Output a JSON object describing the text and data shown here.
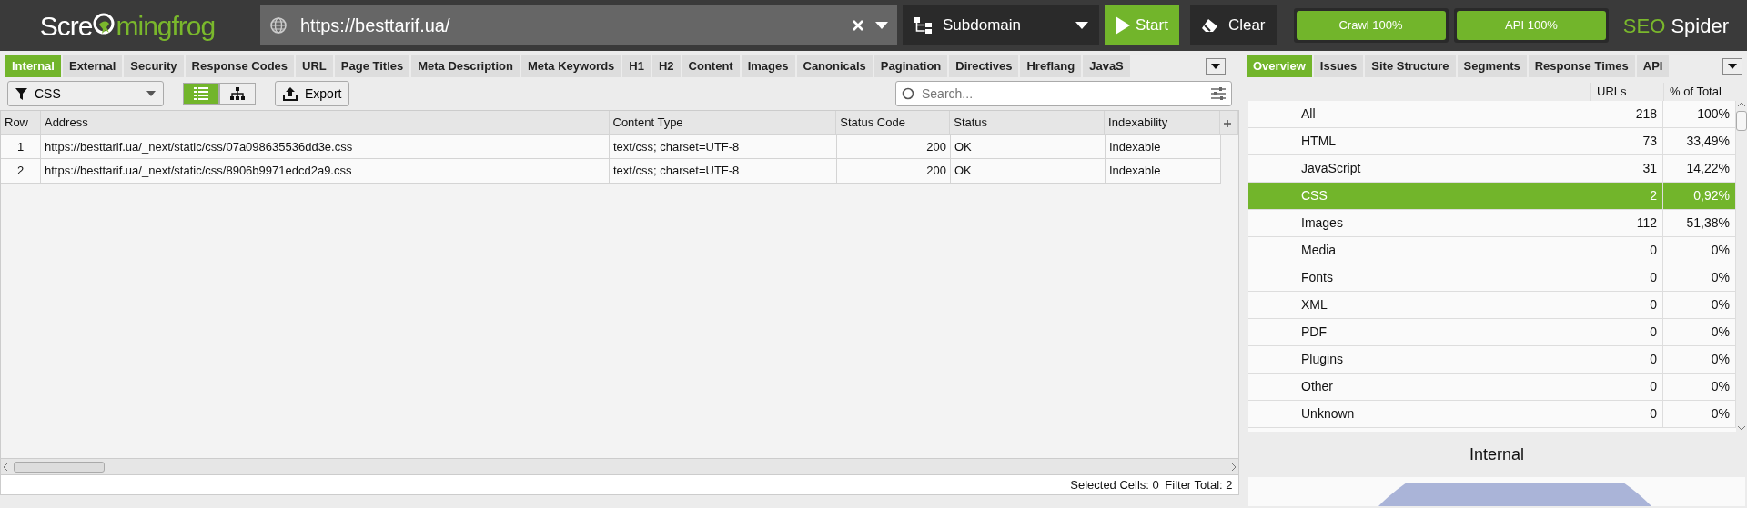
{
  "logo": {
    "before": "Scre",
    "after": "mingfrog"
  },
  "url_field": {
    "value": "https://besttarif.ua/"
  },
  "mode_dropdown": {
    "value": "Subdomain"
  },
  "buttons": {
    "start": "Start",
    "clear": "Clear"
  },
  "progress": [
    {
      "label": "Crawl 100%",
      "level": 1
    },
    {
      "label": "API 100%",
      "level": 1
    }
  ],
  "product": {
    "highlight": "SEO",
    "rest": "Spider"
  },
  "left_tabs": [
    {
      "label": "Internal",
      "selected": true
    },
    {
      "label": "External",
      "selected": false
    },
    {
      "label": "Security",
      "selected": false
    },
    {
      "label": "Response Codes",
      "selected": false
    },
    {
      "label": "URL",
      "selected": false
    },
    {
      "label": "Page Titles",
      "selected": false
    },
    {
      "label": "Meta Description",
      "selected": false
    },
    {
      "label": "Meta Keywords",
      "selected": false
    },
    {
      "label": "H1",
      "selected": false
    },
    {
      "label": "H2",
      "selected": false
    },
    {
      "label": "Content",
      "selected": false
    },
    {
      "label": "Images",
      "selected": false
    },
    {
      "label": "Canonicals",
      "selected": false
    },
    {
      "label": "Pagination",
      "selected": false
    },
    {
      "label": "Directives",
      "selected": false
    },
    {
      "label": "Hreflang",
      "selected": false
    },
    {
      "label": "JavaS",
      "selected": false
    }
  ],
  "filter_dropdown": {
    "value": "CSS"
  },
  "view_toggle": [
    {
      "kind": "list",
      "selected": true
    },
    {
      "kind": "tree",
      "selected": false
    }
  ],
  "export_button": "Export",
  "search": {
    "placeholder": "Search..."
  },
  "table": {
    "columns": [
      "Row",
      "Address",
      "Content Type",
      "Status Code",
      "Status",
      "Indexability"
    ],
    "rows": [
      [
        "1",
        "https://besttarif.ua/_next/static/css/07a098635536dd3e.css",
        "text/css; charset=UTF-8",
        "200",
        "OK",
        "Indexable"
      ],
      [
        "2",
        "https://besttarif.ua/_next/static/css/8906b9971edcd2a9.css",
        "text/css; charset=UTF-8",
        "200",
        "OK",
        "Indexable"
      ]
    ]
  },
  "status_bar": [
    {
      "label": "Selected Cells:",
      "value": "0"
    },
    {
      "label": "Filter Total:",
      "value": "2"
    }
  ],
  "right_tabs": [
    {
      "label": "Overview",
      "selected": true
    },
    {
      "label": "Issues",
      "selected": false
    },
    {
      "label": "Site Structure",
      "selected": false
    },
    {
      "label": "Segments",
      "selected": false
    },
    {
      "label": "Response Times",
      "selected": false
    },
    {
      "label": "API",
      "selected": false
    }
  ],
  "overview": {
    "columns": [
      "URLs",
      "% of Total"
    ],
    "rows": [
      {
        "name": "All",
        "urls": "218",
        "percent": "100%",
        "selected": false
      },
      {
        "name": "HTML",
        "urls": "73",
        "percent": "33,49%",
        "selected": false
      },
      {
        "name": "JavaScript",
        "urls": "31",
        "percent": "14,22%",
        "selected": false
      },
      {
        "name": "CSS",
        "urls": "2",
        "percent": "0,92%",
        "selected": true
      },
      {
        "name": "Images",
        "urls": "112",
        "percent": "51,38%",
        "selected": false
      },
      {
        "name": "Media",
        "urls": "0",
        "percent": "0%",
        "selected": false
      },
      {
        "name": "Fonts",
        "urls": "0",
        "percent": "0%",
        "selected": false
      },
      {
        "name": "XML",
        "urls": "0",
        "percent": "0%",
        "selected": false
      },
      {
        "name": "PDF",
        "urls": "0",
        "percent": "0%",
        "selected": false
      },
      {
        "name": "Plugins",
        "urls": "0",
        "percent": "0%",
        "selected": false
      },
      {
        "name": "Other",
        "urls": "0",
        "percent": "0%",
        "selected": false
      },
      {
        "name": "Unknown",
        "urls": "0",
        "percent": "0%",
        "selected": false
      }
    ]
  },
  "chart_title": "Internal"
}
